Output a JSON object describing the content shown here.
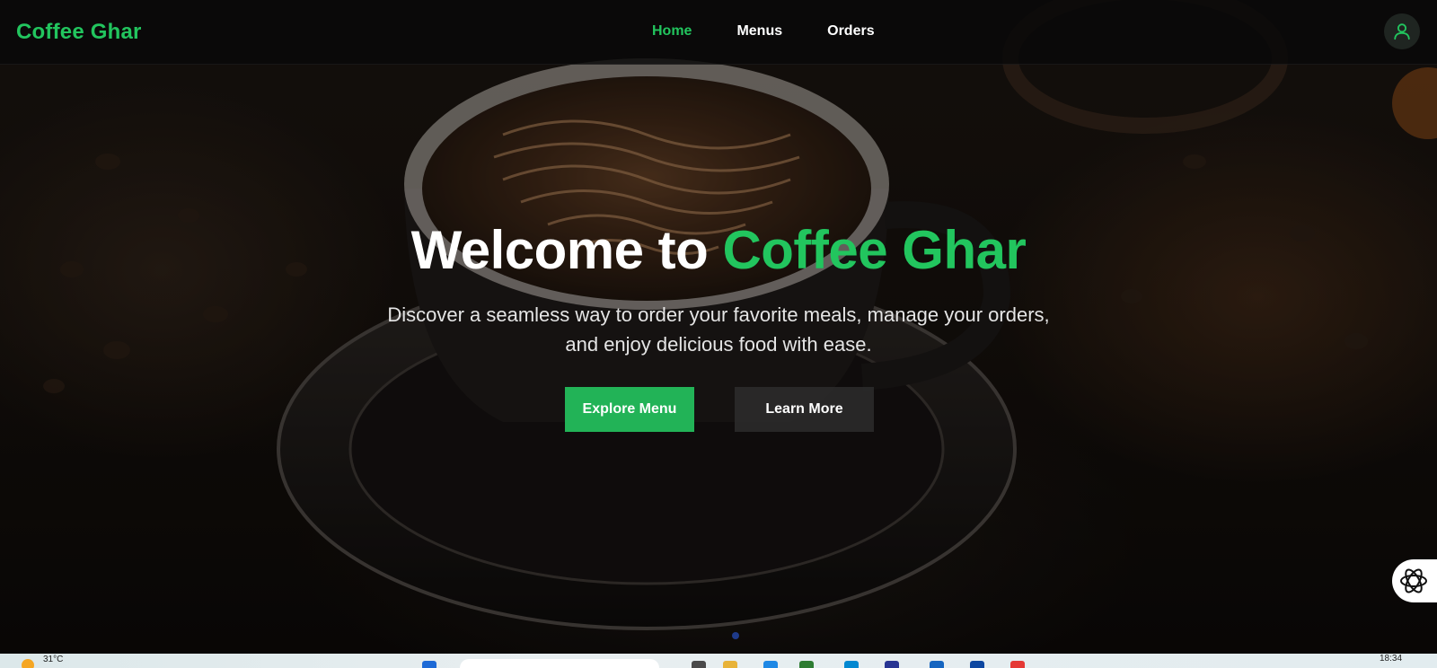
{
  "brand": {
    "name": "Coffee Ghar"
  },
  "nav": {
    "links": [
      {
        "label": "Home",
        "active": true
      },
      {
        "label": "Menus",
        "active": false
      },
      {
        "label": "Orders",
        "active": false
      }
    ],
    "profile_icon": "user-icon"
  },
  "hero": {
    "title_prefix": "Welcome to",
    "title_accent": "Coffee Ghar",
    "subtitle": "Discover a seamless way to order your favorite meals, manage your orders, and enjoy delicious food with ease.",
    "primary_button": "Explore Menu",
    "secondary_button": "Learn More"
  },
  "assistant": {
    "icon": "assistant-logo-icon"
  },
  "taskbar": {
    "temperature": "31°C",
    "time": "18:34"
  },
  "colors": {
    "accent": "#22c55e",
    "primary_button": "#22b357",
    "nav_background": "#080808",
    "secondary_button": "#2d2d2d"
  }
}
